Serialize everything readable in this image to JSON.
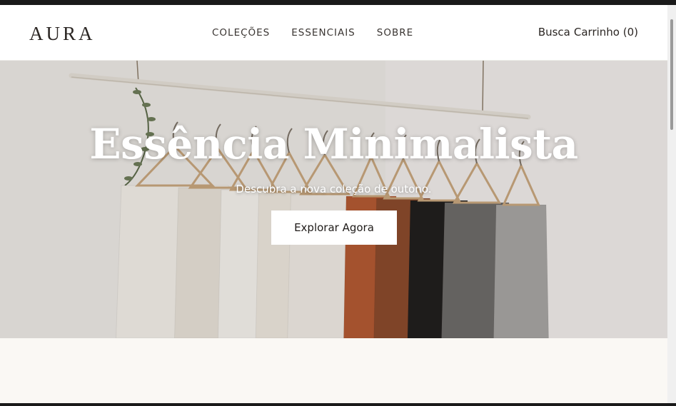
{
  "brand": {
    "logo": "AURA"
  },
  "nav": [
    {
      "label": "COLEÇÕES"
    },
    {
      "label": "ESSENCIAIS"
    },
    {
      "label": "SOBRE"
    }
  ],
  "header_actions": {
    "search_label": "Busca",
    "cart_label": "Carrinho (0)"
  },
  "hero": {
    "title": "Essência Minimalista",
    "subtitle": "Descubra a nova coleção de outono.",
    "cta_label": "Explorar Agora",
    "garment_colors": [
      "#f4f1ea",
      "#e9e4da",
      "#f6f4ef",
      "#efe9df",
      "#f1ede6",
      "#b45a32",
      "#8b4a2b",
      "#1f1d1c",
      "#6d6b69",
      "#a7a6a4"
    ]
  },
  "colors": {
    "accent": "#ffffff",
    "text": "#2b2623",
    "background": "#faf8f4"
  }
}
